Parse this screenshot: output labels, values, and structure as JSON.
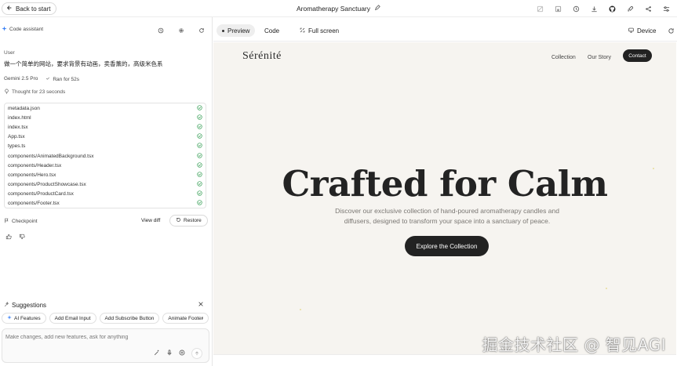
{
  "topbar": {
    "back_label": "Back to start",
    "app_title": "Aromatherapy Sanctuary",
    "icons": [
      "image-off-icon",
      "save-icon",
      "history-icon",
      "download-icon",
      "github-icon",
      "rocket-icon",
      "share-icon",
      "settings-sliders-icon"
    ]
  },
  "assistant": {
    "label": "Code assistant",
    "icons": [
      "history-icon",
      "gear-icon",
      "refresh-icon"
    ]
  },
  "conversation": {
    "user_label": "User",
    "user_message": "做一个简单的网站，要求背景有动画，卖香薰的，高级米色系",
    "model": "Gemini 2.5 Pro",
    "ran_for": "Ran for 52s",
    "thought": "Thought for 23 seconds"
  },
  "files": [
    "metadata.json",
    "index.html",
    "index.tsx",
    "App.tsx",
    "types.ts",
    "components/AnimatedBackground.tsx",
    "components/Header.tsx",
    "components/Hero.tsx",
    "components/ProductShowcase.tsx",
    "components/ProductCard.tsx",
    "components/Footer.tsx"
  ],
  "checkpoint": {
    "label": "Checkpoint",
    "view_diff": "View diff",
    "restore": "Restore"
  },
  "suggestions": {
    "title": "Suggestions",
    "chips": [
      "AI Features",
      "Add Email Input",
      "Add Subscribe Button",
      "Animate Footer"
    ]
  },
  "input": {
    "placeholder": "Make changes, add new features, ask for anything"
  },
  "tabs": {
    "preview": "Preview",
    "code": "Code",
    "fullscreen": "Full screen",
    "device": "Device"
  },
  "site": {
    "brand": "Sérénité",
    "nav": [
      "Collection",
      "Our Story"
    ],
    "contact": "Contact",
    "hero_title": "Crafted for Calm",
    "hero_subtitle": "Discover our exclusive collection of hand-poured aromatherapy candles and diffusers, designed to transform your space into a sanctuary of peace.",
    "cta": "Explore the Collection",
    "background": "#f6f4f0",
    "accent": "#222222"
  },
  "watermark": "掘金技术社区 @ 智见AGI"
}
